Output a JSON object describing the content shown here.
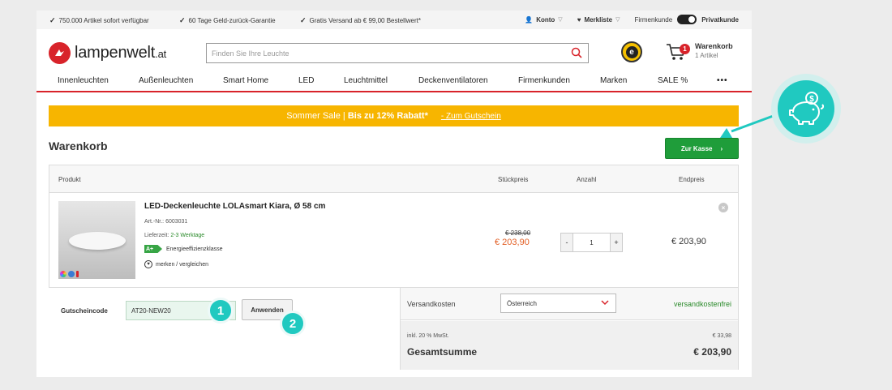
{
  "topbar": {
    "benefits": [
      "750.000 Artikel sofort verfügbar",
      "60 Tage Geld-zurück-Garantie",
      "Gratis Versand ab € 99,00 Bestellwert*"
    ],
    "account": "Konto",
    "wishlist": "Merkliste",
    "business": "Firmenkunde",
    "private": "Privatkunde"
  },
  "header": {
    "logo_text": "lampenwelt",
    "logo_tld": ".at",
    "search_placeholder": "Finden Sie Ihre Leuchte",
    "cart_label": "Warenkorb",
    "cart_sub": "1 Artikel",
    "cart_count": "1",
    "trust_badge": "e"
  },
  "nav": {
    "items": [
      "Innenleuchten",
      "Außenleuchten",
      "Smart Home",
      "LED",
      "Leuchtmittel",
      "Deckenventilatoren",
      "Firmenkunden",
      "Marken",
      "SALE %"
    ],
    "more": "•••"
  },
  "banner": {
    "text1": "Sommer Sale |",
    "text2": "Bis zu 12% Rabatt*",
    "link": "- Zum Gutschein"
  },
  "page": {
    "title": "Warenkorb",
    "checkout": "Zur Kasse",
    "checkout_arrow": "›"
  },
  "table": {
    "headers": {
      "product": "Produkt",
      "unit_price": "Stückpreis",
      "qty": "Anzahl",
      "total": "Endpreis"
    }
  },
  "item": {
    "name": "LED-Deckenleuchte LOLAsmart Kiara, Ø 58 cm",
    "art_label": "Art.-Nr.:",
    "art_no": "6003031",
    "delivery_label": "Lieferzeit:",
    "delivery": "2-3 Werktage",
    "energy_class": "A+",
    "energy_label": "Energieeffizienzklasse",
    "wishlist": "merken / vergleichen",
    "price_old": "€ 238,00",
    "price_new": "€ 203,90",
    "qty": "1",
    "minus": "-",
    "plus": "+",
    "total": "€ 203,90",
    "remove": "×"
  },
  "voucher": {
    "label": "Gutscheincode",
    "value": "AT20-NEW20",
    "apply": "Anwenden",
    "step1": "1",
    "step2": "2"
  },
  "summary": {
    "shipping_label": "Versandkosten",
    "country": "Österreich",
    "shipping_value": "versandkostenfrei",
    "vat_label": "inkl. 20 % MwSt.",
    "vat_value": "€ 33,98",
    "total_label": "Gesamtsumme",
    "total_value": "€ 203,90"
  },
  "colors": {
    "brand_red": "#d8232a",
    "sale_yellow": "#f7b500",
    "checkout_green": "#1f9d3a",
    "accent_teal": "#20c9c0",
    "price_orange": "#e25d22"
  }
}
